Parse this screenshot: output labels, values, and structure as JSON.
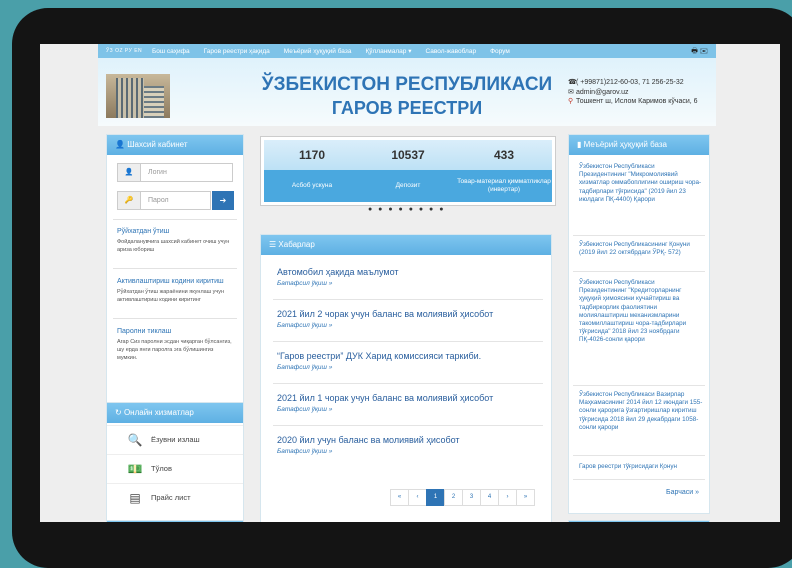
{
  "nav": {
    "langs": "ЎЗ ОZ РУ EN",
    "items": [
      "Бош саҳифа",
      "Гаров реестри ҳақида",
      "Меъёрий ҳуқуқий база",
      "Қўлланмалар ▾",
      "Савол-жавоблар",
      "Форум"
    ]
  },
  "header": {
    "title_line1": "ЎЗБЕКИСТОН РЕСПУБЛИКАСИ",
    "title_line2": "ГАРОВ РЕЕСТРИ",
    "phone": "( +99871)212-60-03, 71 256-25-32",
    "email": "admin@garov.uz",
    "address": "Тошкент ш, Ислом Каримов кўчаси, 6"
  },
  "cabinet": {
    "title": "Шахсий кабинет",
    "login_placeholder": "Логин",
    "password_placeholder": "Парол",
    "links": [
      {
        "title": "Рўйхатдан ўтиш",
        "desc": "Фойдаланувчига шахсий кабинет очиш учун ариза юбориш"
      },
      {
        "title": "Активлаштириш кодини киритиш",
        "desc": "Рўйхатдан ўтиш жараёнини якунлаш учун активлаштириш кодини киритинг"
      },
      {
        "title": "Паролни тиклаш",
        "desc": "Агар Сиз паролни эсдан чиқарган бўлсангиз, шу ерда янги паролга эга бўлишингиз мумкин."
      }
    ]
  },
  "services": {
    "title": "Онлайн хизматлар",
    "items": [
      "Ёзувни излаш",
      "Тўлов",
      "Прайс лист"
    ]
  },
  "stats": [
    {
      "value": "1170",
      "label": "Асбоб ускуна"
    },
    {
      "value": "10537",
      "label": "Депозит"
    },
    {
      "value": "433",
      "label": "Товар-материал қимматликлар (инвертар)"
    }
  ],
  "carousel_dots": "● ● ● ● ● ● ● ●",
  "news": {
    "title": "Хабарлар",
    "more_label": "Батафсил ўқиш »",
    "items": [
      "Автомобил ҳақида маълумот",
      "2021 йил 2 чорак учун баланс ва молиявий ҳисобот",
      "“Гаров реестри” ДУК Харид комиссияси таркиби.",
      "2021 йил 1 чорак учун баланс ва молиявий ҳисобот",
      "2020 йил учун баланс ва молиявий ҳисобот"
    ],
    "pager": [
      "«",
      "‹",
      "1",
      "2",
      "3",
      "4",
      "›",
      "»"
    ]
  },
  "legal": {
    "title": "Меъёрий ҳуқуқий база",
    "items": [
      "Ўзбекистон Республикаси Президентининг \"Микромолиявий хизматлар оммабоплигини ошириш чора-тадбирлари тўғрисида\" (2019 йил 23 июлдаги ПҚ-4400) Қарори",
      "Ўзбекистон Республикасининг Қонуни (2019 йил 22 октябрдаги ЎРҚ- 572)",
      "Ўзбекистон Республикаси Президентининг \"Кредиторларнинг ҳуқуқий ҳимоясини кучайтириш ва тадбиркорлик фаолиятини молиялаштириш механизмларини такомиллаштириш чора-тадбирлари тўғрисида\" 2018 йил 23 ноябрдаги ПҚ-4026-сонли қарори",
      "Ўзбекистон Республикаси Вазирлар Маҳкамасининг 2014 йил 12 июндаги 155-сонли қарорига ўзгартиришлар киритиш тўғрисида 2018 йил 29 декабрдаги 1058-сонли қарори",
      "Гаров реестри тўғрисидаги Қонун"
    ],
    "all_label": "Барчаси »"
  }
}
